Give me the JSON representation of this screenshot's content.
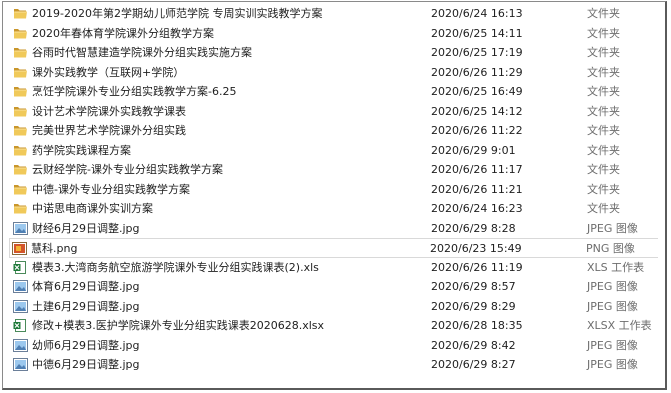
{
  "files": [
    {
      "name": "2019-2020年第2学期幼儿师范学院  专周实训实践教学方案",
      "date": "2020/6/24 16:13",
      "type": "文件夹",
      "icon": "folder-icon"
    },
    {
      "name": "2020年春体育学院课外分组教学方案",
      "date": "2020/6/25 14:11",
      "type": "文件夹",
      "icon": "folder-icon"
    },
    {
      "name": "谷雨时代智慧建造学院课外分组实践实施方案",
      "date": "2020/6/25 17:19",
      "type": "文件夹",
      "icon": "folder-icon"
    },
    {
      "name": "课外实践教学（互联网+学院）",
      "date": "2020/6/26 11:29",
      "type": "文件夹",
      "icon": "folder-icon"
    },
    {
      "name": "烹饪学院课外专业分组实践教学方案-6.25",
      "date": "2020/6/25 16:49",
      "type": "文件夹",
      "icon": "folder-icon"
    },
    {
      "name": "设计艺术学院课外实践教学课表",
      "date": "2020/6/25 14:12",
      "type": "文件夹",
      "icon": "folder-icon"
    },
    {
      "name": "完美世界艺术学院课外分组实践",
      "date": "2020/6/26 11:22",
      "type": "文件夹",
      "icon": "folder-icon"
    },
    {
      "name": "药学院实践课程方案",
      "date": "2020/6/29 9:01",
      "type": "文件夹",
      "icon": "folder-icon"
    },
    {
      "name": "云财经学院-课外专业分组实践教学方案",
      "date": "2020/6/26 11:17",
      "type": "文件夹",
      "icon": "folder-icon"
    },
    {
      "name": "中德-课外专业分组实践教学方案",
      "date": "2020/6/26 11:21",
      "type": "文件夹",
      "icon": "folder-icon"
    },
    {
      "name": "中诺思电商课外实训方案",
      "date": "2020/6/24 16:23",
      "type": "文件夹",
      "icon": "folder-icon"
    },
    {
      "name": "财经6月29日调整.jpg",
      "date": "2020/6/29 8:28",
      "type": "JPEG 图像",
      "icon": "jpeg-image-icon"
    },
    {
      "name": "慧科.png",
      "date": "2020/6/23 15:49",
      "type": "PNG 图像",
      "icon": "png-image-icon"
    },
    {
      "name": "模表3.大湾商务航空旅游学院课外专业分组实践课表(2).xls",
      "date": "2020/6/26 11:19",
      "type": "XLS 工作表",
      "icon": "xls-file-icon"
    },
    {
      "name": "体育6月29日调整.jpg",
      "date": "2020/6/29 8:57",
      "type": "JPEG 图像",
      "icon": "jpeg-image-icon"
    },
    {
      "name": "土建6月29日调整.jpg",
      "date": "2020/6/29 8:29",
      "type": "JPEG 图像",
      "icon": "jpeg-image-icon"
    },
    {
      "name": "修改+模表3.医护学院课外专业分组实践课表2020628.xlsx",
      "date": "2020/6/28 18:35",
      "type": "XLSX 工作表",
      "icon": "xlsx-file-icon"
    },
    {
      "name": "幼师6月29日调整.jpg",
      "date": "2020/6/29 8:42",
      "type": "JPEG 图像",
      "icon": "jpeg-image-icon"
    },
    {
      "name": "中德6月29日调整.jpg",
      "date": "2020/6/29 8:27",
      "type": "JPEG 图像",
      "icon": "jpeg-image-icon"
    }
  ],
  "colors": {
    "folder": "#e8b84a",
    "folder_dark": "#c9962b",
    "excel": "#1f7a3a"
  }
}
